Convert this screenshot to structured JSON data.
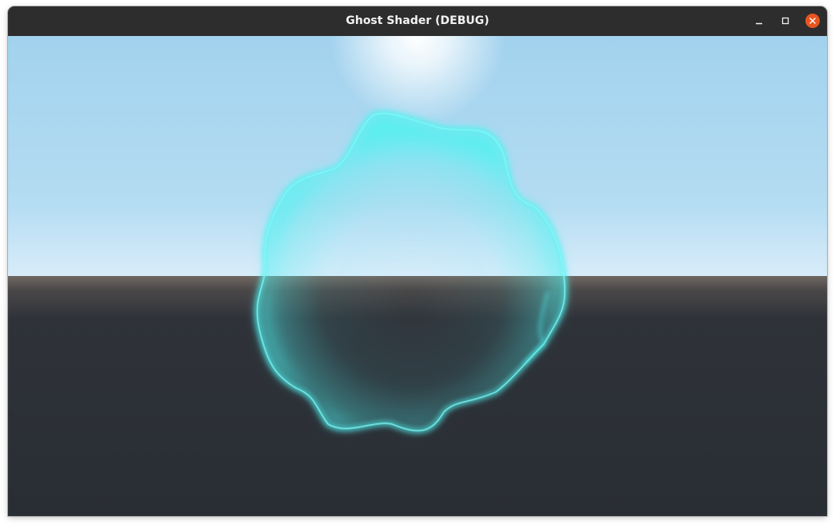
{
  "window": {
    "title": "Ghost Shader (DEBUG)",
    "controls": {
      "minimize_icon": "minimize-icon",
      "maximize_icon": "maximize-icon",
      "close_icon": "close-icon",
      "close_color": "#e95420"
    }
  },
  "scene": {
    "sky_top_color": "#a2d2ee",
    "sky_horizon_color": "#d8ecfa",
    "ground_horizon_color": "#6f6863",
    "ground_color": "#292d34",
    "ghost_rim_color": "#4ff2f0"
  }
}
